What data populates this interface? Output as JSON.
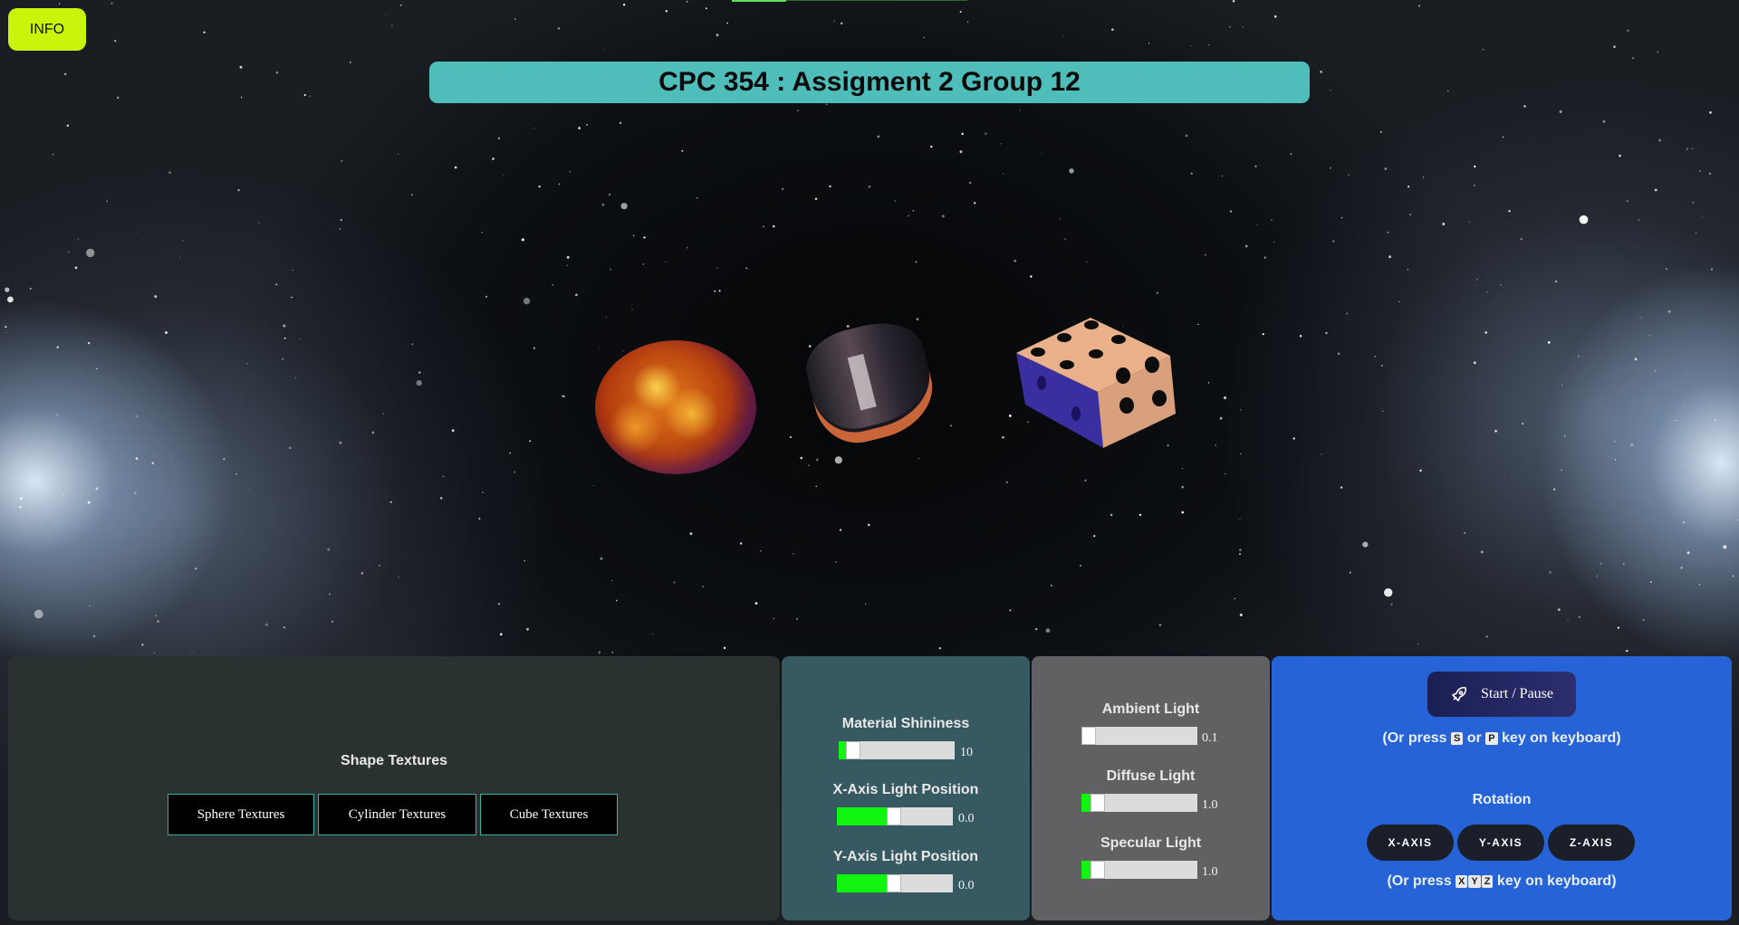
{
  "header": {
    "info_label": "INFO",
    "title": "CPC 354 : Assigment 2 Group 12"
  },
  "textures": {
    "heading": "Shape Textures",
    "buttons": [
      "Sphere Textures",
      "Cylinder Textures",
      "Cube Textures"
    ]
  },
  "material": {
    "shininess_label": "Material Shininess",
    "shininess_value": "10",
    "x_light_label": "X-Axis Light Position",
    "x_light_value": "0.0",
    "y_light_label": "Y-Axis Light Position",
    "y_light_value": "0.0"
  },
  "lighting": {
    "ambient_label": "Ambient Light",
    "ambient_value": "0.1",
    "diffuse_label": "Diffuse Light",
    "diffuse_value": "1.0",
    "specular_label": "Specular Light",
    "specular_value": "1.0"
  },
  "animation": {
    "start_label": "Start / Pause",
    "start_icon": "rocket-icon",
    "start_hint_prefix": "(Or press",
    "start_key_1": "S",
    "start_hint_or": "or",
    "start_key_2": "P",
    "start_hint_suffix": "key on keyboard)",
    "rotation_heading": "Rotation",
    "axis_buttons": [
      "X-AXIS",
      "Y-AXIS",
      "Z-AXIS"
    ],
    "rotation_hint_prefix": "(Or press",
    "rotation_keys": [
      "X",
      "Y",
      "Z"
    ],
    "rotation_hint_suffix": "key on keyboard)"
  },
  "colors": {
    "info_button": "#c8f50a",
    "title_banner": "#4fbdb9",
    "textures_panel": "#2a3131",
    "material_panel": "#375a62",
    "lighting_panel": "#616164",
    "animation_panel": "#2563d6",
    "slider_fill": "#11f511"
  }
}
